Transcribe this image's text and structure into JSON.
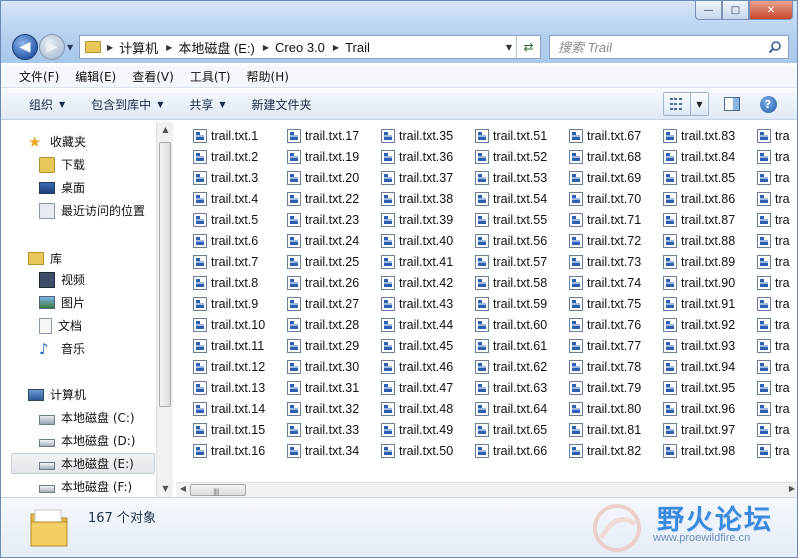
{
  "window": {
    "buttons": {
      "minimize": "—",
      "maximize": "□",
      "close": "✕"
    }
  },
  "address": {
    "crumbs": [
      "计算机",
      "本地磁盘 (E:)",
      "Creo 3.0",
      "Trail"
    ]
  },
  "search": {
    "placeholder": "搜索 Trail"
  },
  "menubar": {
    "items": [
      "文件(F)",
      "编辑(E)",
      "查看(V)",
      "工具(T)",
      "帮助(H)"
    ]
  },
  "toolbar": {
    "organize": "组织",
    "include_in_library": "包含到库中",
    "share": "共享",
    "new_folder": "新建文件夹"
  },
  "navpane": {
    "favorites": {
      "header": "收藏夹",
      "items": [
        "下载",
        "桌面",
        "最近访问的位置"
      ]
    },
    "libraries": {
      "header": "库",
      "items": [
        "视频",
        "图片",
        "文档",
        "音乐"
      ]
    },
    "computer": {
      "header": "计算机",
      "items": [
        "本地磁盘 (C:)",
        "本地磁盘 (D:)",
        "本地磁盘 (E:)",
        "本地磁盘 (F:)"
      ],
      "selected": "本地磁盘 (E:)"
    }
  },
  "files": {
    "columns": [
      [
        "trail.txt.1",
        "trail.txt.2",
        "trail.txt.3",
        "trail.txt.4",
        "trail.txt.5",
        "trail.txt.6",
        "trail.txt.7",
        "trail.txt.8",
        "trail.txt.9",
        "trail.txt.10",
        "trail.txt.11",
        "trail.txt.12",
        "trail.txt.13",
        "trail.txt.14",
        "trail.txt.15",
        "trail.txt.16"
      ],
      [
        "trail.txt.17",
        "trail.txt.19",
        "trail.txt.20",
        "trail.txt.22",
        "trail.txt.23",
        "trail.txt.24",
        "trail.txt.25",
        "trail.txt.26",
        "trail.txt.27",
        "trail.txt.28",
        "trail.txt.29",
        "trail.txt.30",
        "trail.txt.31",
        "trail.txt.32",
        "trail.txt.33",
        "trail.txt.34"
      ],
      [
        "trail.txt.35",
        "trail.txt.36",
        "trail.txt.37",
        "trail.txt.38",
        "trail.txt.39",
        "trail.txt.40",
        "trail.txt.41",
        "trail.txt.42",
        "trail.txt.43",
        "trail.txt.44",
        "trail.txt.45",
        "trail.txt.46",
        "trail.txt.47",
        "trail.txt.48",
        "trail.txt.49",
        "trail.txt.50"
      ],
      [
        "trail.txt.51",
        "trail.txt.52",
        "trail.txt.53",
        "trail.txt.54",
        "trail.txt.55",
        "trail.txt.56",
        "trail.txt.57",
        "trail.txt.58",
        "trail.txt.59",
        "trail.txt.60",
        "trail.txt.61",
        "trail.txt.62",
        "trail.txt.63",
        "trail.txt.64",
        "trail.txt.65",
        "trail.txt.66"
      ],
      [
        "trail.txt.67",
        "trail.txt.68",
        "trail.txt.69",
        "trail.txt.70",
        "trail.txt.71",
        "trail.txt.72",
        "trail.txt.73",
        "trail.txt.74",
        "trail.txt.75",
        "trail.txt.76",
        "trail.txt.77",
        "trail.txt.78",
        "trail.txt.79",
        "trail.txt.80",
        "trail.txt.81",
        "trail.txt.82"
      ],
      [
        "trail.txt.83",
        "trail.txt.84",
        "trail.txt.85",
        "trail.txt.86",
        "trail.txt.87",
        "trail.txt.88",
        "trail.txt.89",
        "trail.txt.90",
        "trail.txt.91",
        "trail.txt.92",
        "trail.txt.93",
        "trail.txt.94",
        "trail.txt.95",
        "trail.txt.96",
        "trail.txt.97",
        "trail.txt.98"
      ],
      [
        "tra",
        "tra",
        "tra",
        "tra",
        "tra",
        "tra",
        "tra",
        "tra",
        "tra",
        "tra",
        "tra",
        "tra",
        "tra",
        "tra",
        "tra",
        "tra"
      ]
    ]
  },
  "details": {
    "count": "167 个对象"
  },
  "watermark": {
    "title": "野火论坛",
    "url": "www.proewildfire.cn"
  },
  "colors": {
    "accent": "#3a8ae0",
    "chrome": "#b9d3f0",
    "selection": "#e3e6ea"
  }
}
